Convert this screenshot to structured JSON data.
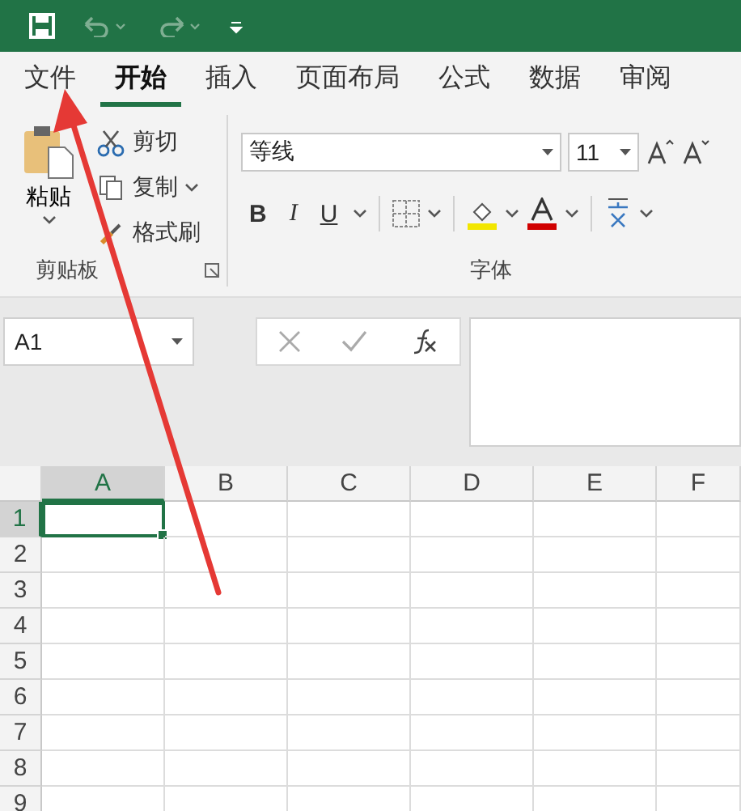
{
  "tabs": [
    {
      "label": "文件",
      "selected": false
    },
    {
      "label": "开始",
      "selected": true
    },
    {
      "label": "插入",
      "selected": false
    },
    {
      "label": "页面布局",
      "selected": false
    },
    {
      "label": "公式",
      "selected": false
    },
    {
      "label": "数据",
      "selected": false
    },
    {
      "label": "审阅",
      "selected": false
    }
  ],
  "clipboard": {
    "paste_label": "粘贴",
    "items": [
      {
        "kind": "cut",
        "label": "剪切"
      },
      {
        "kind": "copy",
        "label": "复制"
      },
      {
        "kind": "painter",
        "label": "格式刷"
      }
    ],
    "group_label": "剪贴板"
  },
  "font": {
    "font_name": "等线",
    "font_size": "11",
    "styles": [
      "B",
      "I",
      "U"
    ],
    "group_label": "字体"
  },
  "formula_bar": {
    "name_box": "A1"
  },
  "columns": [
    {
      "label": "A",
      "selected": true
    },
    {
      "label": "B",
      "selected": false
    },
    {
      "label": "C",
      "selected": false
    },
    {
      "label": "D",
      "selected": false
    },
    {
      "label": "E",
      "selected": false
    },
    {
      "label": "F",
      "selected": false
    }
  ],
  "rows": [
    {
      "label": "1",
      "selected": true
    },
    {
      "label": "2",
      "selected": false
    },
    {
      "label": "3",
      "selected": false
    },
    {
      "label": "4",
      "selected": false
    },
    {
      "label": "5",
      "selected": false
    },
    {
      "label": "6",
      "selected": false
    },
    {
      "label": "7",
      "selected": false
    },
    {
      "label": "8",
      "selected": false
    },
    {
      "label": "9",
      "selected": false
    }
  ]
}
